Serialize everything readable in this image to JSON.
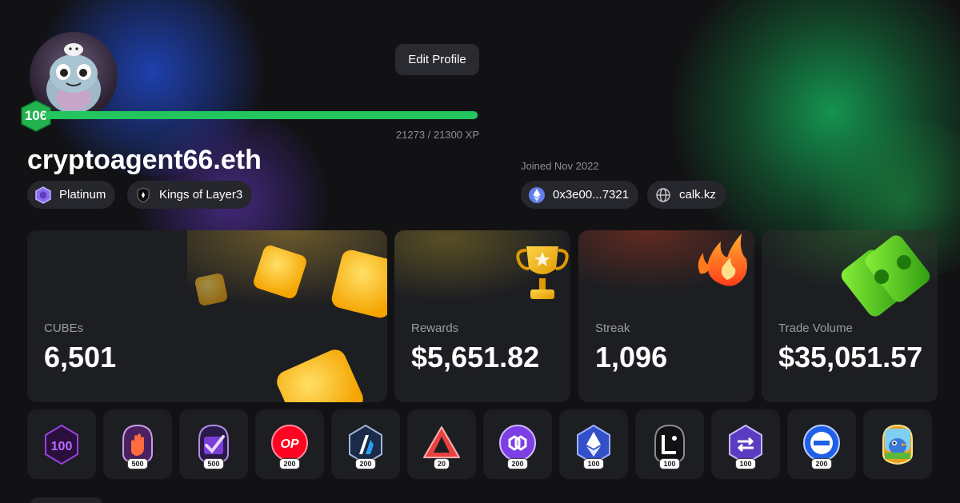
{
  "profile": {
    "username": "cryptoagent66.eth",
    "level": "106",
    "xp_text": "21273 / 21300 XP",
    "xp_fraction": 0.9987,
    "edit_label": "Edit Profile",
    "joined": "Joined Nov 2022"
  },
  "tags": [
    {
      "label": "Platinum",
      "icon": "platinum-hexagon-icon"
    },
    {
      "label": "Kings of Layer3",
      "icon": "shield-icon"
    }
  ],
  "links": [
    {
      "label": "0x3e00...7321",
      "icon": "ethereum-icon"
    },
    {
      "label": "calk.kz",
      "icon": "globe-icon"
    }
  ],
  "stats": [
    {
      "label": "CUBEs",
      "value": "6,501",
      "icon": "cubes-icon"
    },
    {
      "label": "Rewards",
      "value": "$5,651.82",
      "icon": "trophy-icon"
    },
    {
      "label": "Streak",
      "value": "1,096",
      "icon": "flame-icon"
    },
    {
      "label": "Trade Volume",
      "value": "$35,051.57",
      "icon": "money-icon"
    }
  ],
  "badges": [
    {
      "name": "badge-100",
      "count": ""
    },
    {
      "name": "badge-hand",
      "count": "500"
    },
    {
      "name": "badge-check",
      "count": "500"
    },
    {
      "name": "badge-op",
      "count": "200",
      "text": "OP"
    },
    {
      "name": "badge-arbitrum",
      "count": "200"
    },
    {
      "name": "badge-avalanche",
      "count": "20"
    },
    {
      "name": "badge-polygon",
      "count": "200"
    },
    {
      "name": "badge-ethereum",
      "count": "100"
    },
    {
      "name": "badge-linea",
      "count": "100"
    },
    {
      "name": "badge-bridge",
      "count": "100"
    },
    {
      "name": "badge-minus",
      "count": "200"
    },
    {
      "name": "badge-bird",
      "count": ""
    }
  ],
  "colors": {
    "background": "#121214",
    "card": "#1d1e22",
    "xp_bar": "#22c55e",
    "accent_green": "#22c55e"
  }
}
